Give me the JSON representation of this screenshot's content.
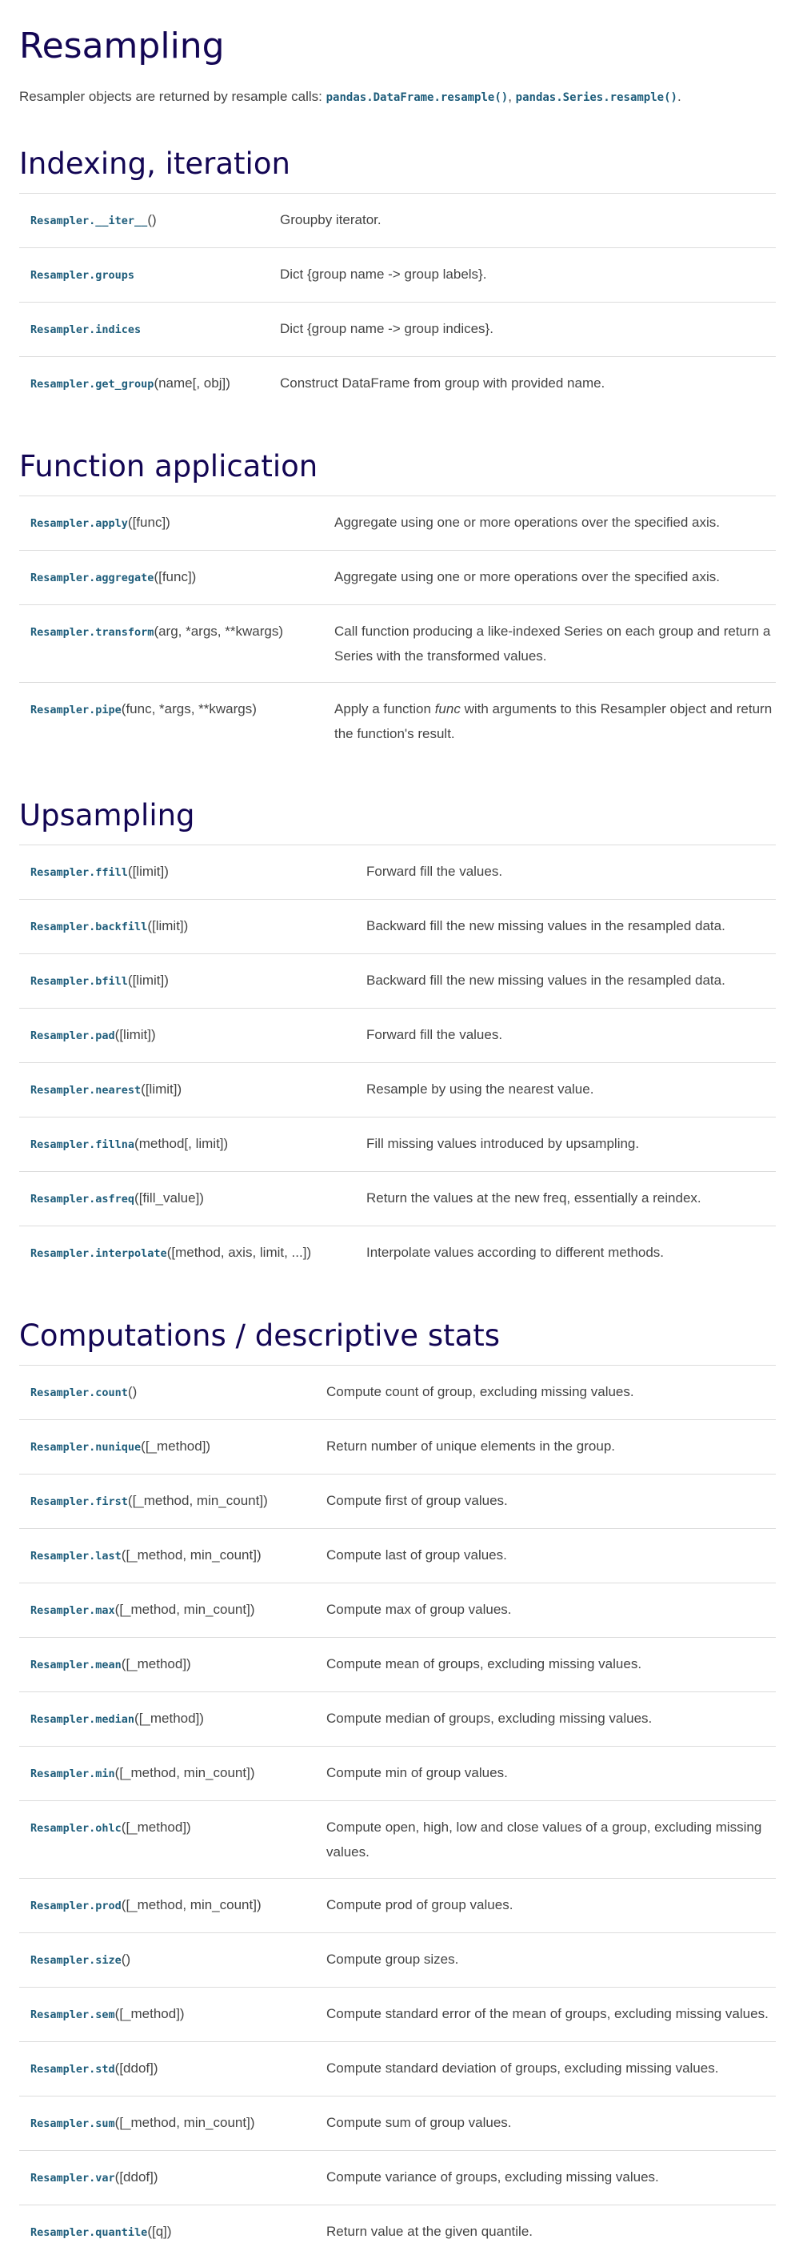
{
  "page": {
    "title": "Resampling",
    "lead": {
      "text": "Resampler objects are returned by resample calls:",
      "code1": "pandas.DataFrame.resample()",
      "sep": ", ",
      "code2": "pandas.Series.resample()",
      "end": "."
    }
  },
  "sections": [
    {
      "heading": "Indexing, iteration",
      "rows": [
        {
          "name": "Resampler.__iter__",
          "args": "()",
          "desc": "Groupby iterator."
        },
        {
          "name": "Resampler.groups",
          "args": "",
          "desc": "Dict {group name -> group labels}."
        },
        {
          "name": "Resampler.indices",
          "args": "",
          "desc": "Dict {group name -> group indices}."
        },
        {
          "name": "Resampler.get_group",
          "args": "(name[, obj])",
          "desc": "Construct DataFrame from group with provided name."
        }
      ]
    },
    {
      "heading": "Function application",
      "rows": [
        {
          "name": "Resampler.apply",
          "args": "([func])",
          "desc": "Aggregate using one or more operations over the specified axis."
        },
        {
          "name": "Resampler.aggregate",
          "args": "([func])",
          "desc": "Aggregate using one or more operations over the specified axis."
        },
        {
          "name": "Resampler.transform",
          "args": "(arg, *args, **kwargs)",
          "desc": "Call function producing a like-indexed Series on each group and return a Series with the transformed values."
        },
        {
          "name": "Resampler.pipe",
          "args": "(func, *args, **kwargs)",
          "desc_pre": "Apply a function ",
          "desc_em": "func",
          "desc_post": " with arguments to this Resampler object and return the function's result."
        }
      ]
    },
    {
      "heading": "Upsampling",
      "rows": [
        {
          "name": "Resampler.ffill",
          "args": "([limit])",
          "desc": "Forward fill the values."
        },
        {
          "name": "Resampler.backfill",
          "args": "([limit])",
          "desc": "Backward fill the new missing values in the resampled data."
        },
        {
          "name": "Resampler.bfill",
          "args": "([limit])",
          "desc": "Backward fill the new missing values in the resampled data."
        },
        {
          "name": "Resampler.pad",
          "args": "([limit])",
          "desc": "Forward fill the values."
        },
        {
          "name": "Resampler.nearest",
          "args": "([limit])",
          "desc": "Resample by using the nearest value."
        },
        {
          "name": "Resampler.fillna",
          "args": "(method[, limit])",
          "desc": "Fill missing values introduced by upsampling."
        },
        {
          "name": "Resampler.asfreq",
          "args": "([fill_value])",
          "desc": "Return the values at the new freq, essentially a reindex."
        },
        {
          "name": "Resampler.interpolate",
          "args": "([method, axis, limit, ...])",
          "desc": "Interpolate values according to different methods."
        }
      ]
    },
    {
      "heading": "Computations / descriptive stats",
      "rows": [
        {
          "name": "Resampler.count",
          "args": "()",
          "desc": "Compute count of group, excluding missing values."
        },
        {
          "name": "Resampler.nunique",
          "args": "([_method])",
          "desc": "Return number of unique elements in the group."
        },
        {
          "name": "Resampler.first",
          "args": "([_method, min_count])",
          "desc": "Compute first of group values."
        },
        {
          "name": "Resampler.last",
          "args": "([_method, min_count])",
          "desc": "Compute last of group values."
        },
        {
          "name": "Resampler.max",
          "args": "([_method, min_count])",
          "desc": "Compute max of group values."
        },
        {
          "name": "Resampler.mean",
          "args": "([_method])",
          "desc": "Compute mean of groups, excluding missing values."
        },
        {
          "name": "Resampler.median",
          "args": "([_method])",
          "desc": "Compute median of groups, excluding missing values."
        },
        {
          "name": "Resampler.min",
          "args": "([_method, min_count])",
          "desc": "Compute min of group values."
        },
        {
          "name": "Resampler.ohlc",
          "args": "([_method])",
          "desc": "Compute open, high, low and close values of a group, excluding missing values."
        },
        {
          "name": "Resampler.prod",
          "args": "([_method, min_count])",
          "desc": "Compute prod of group values."
        },
        {
          "name": "Resampler.size",
          "args": "()",
          "desc": "Compute group sizes."
        },
        {
          "name": "Resampler.sem",
          "args": "([_method])",
          "desc": "Compute standard error of the mean of groups, excluding missing values."
        },
        {
          "name": "Resampler.std",
          "args": "([ddof])",
          "desc": "Compute standard deviation of groups, excluding missing values."
        },
        {
          "name": "Resampler.sum",
          "args": "([_method, min_count])",
          "desc": "Compute sum of group values."
        },
        {
          "name": "Resampler.var",
          "args": "([ddof])",
          "desc": "Compute variance of groups, excluding missing values."
        },
        {
          "name": "Resampler.quantile",
          "args": "([q])",
          "desc": "Return value at the given quantile."
        }
      ]
    }
  ]
}
